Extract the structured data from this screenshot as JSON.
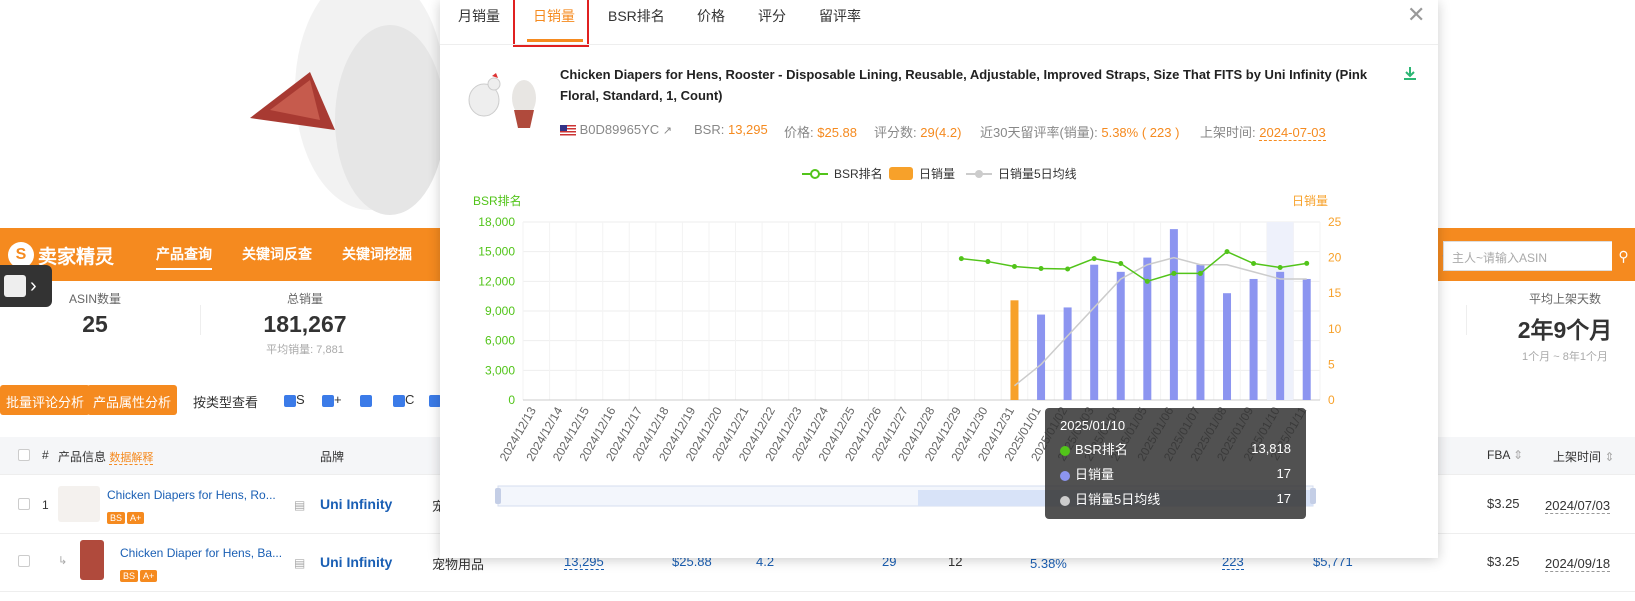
{
  "nav": {
    "logo": "卖家精灵",
    "links": [
      "产品查询",
      "关键词反查",
      "关键词挖掘"
    ],
    "search_placeholder": "主人~请输入ASIN"
  },
  "stats": [
    {
      "label": "ASIN数量",
      "value": "25",
      "sub": ""
    },
    {
      "label": "总销量",
      "value": "181,267",
      "sub": "平均销量: 7,881"
    },
    {
      "label": "平均上架天数",
      "value": "2年9个月",
      "sub": "1个月 ~ 8年1个月"
    }
  ],
  "toolbar": {
    "btn_review": "批量评论分析",
    "btn_attr": "产品属性分析",
    "by_type": "按类型查看",
    "filters": [
      "S",
      "+",
      "",
      "C",
      ""
    ]
  },
  "table": {
    "headers": {
      "num": "#",
      "info": "产品信息",
      "info_link": "数据解释",
      "brand": "品牌",
      "fba": "FBA",
      "date": "上架时间"
    },
    "rows": [
      {
        "num": "1",
        "title": "Chicken Diapers for Hens, Ro...",
        "badges": [
          "BS",
          "A+"
        ],
        "brand": "Uni Infinity",
        "cat": "宠",
        "fba": "$3.25",
        "date": "2024/07/03"
      },
      {
        "num": "",
        "title": "Chicken Diaper for Hens, Ba...",
        "badges": [
          "BS",
          "A+"
        ],
        "brand": "Uni Infinity",
        "cat": "宠物用品",
        "bsr": "13,295",
        "price": "$25.88",
        "rating": "4.2",
        "reviews": "29",
        "x12": "12",
        "rate": "5.38%",
        "n223": "223",
        "rev": "$5,771",
        "fba": "$3.25",
        "date": "2024/09/18"
      }
    ]
  },
  "modal": {
    "tabs": [
      "月销量",
      "日销量",
      "BSR排名",
      "价格",
      "评分",
      "留评率"
    ],
    "active_tab": 1,
    "product_title": "Chicken Diapers for Hens, Rooster - Disposable Lining, Reusable, Adjustable, Improved Straps, Size That FITS by Uni Infinity (Pink Floral, Standard, 1, Count)",
    "asin": "B0D89965YC",
    "bsr_label": "BSR:",
    "bsr": "13,295",
    "price_label": "价格:",
    "price": "$25.88",
    "reviews_label": "评分数:",
    "reviews": "29(4.2)",
    "rate_label": "近30天留评率(销量):",
    "rate": "5.38% ( 223 )",
    "listed_label": "上架时间:",
    "listed": "2024-07-03"
  },
  "tooltip": {
    "date": "2025/01/10",
    "rows": [
      {
        "name": "BSR排名",
        "value": "13,818",
        "color": "#52c41a"
      },
      {
        "name": "日销量",
        "value": "17",
        "color": "#8c95f0"
      },
      {
        "name": "日销量5日均线",
        "value": "17",
        "color": "#cccccc"
      }
    ]
  },
  "chart_data": {
    "type": "bar",
    "title": "",
    "ylabel_left": "BSR排名",
    "ylabel_right": "日销量",
    "ylim_left": [
      0,
      18000
    ],
    "ylim_right": [
      0,
      25
    ],
    "yticks_left": [
      "0",
      "3,000",
      "6,000",
      "9,000",
      "12,000",
      "15,000",
      "18,000"
    ],
    "yticks_right": [
      "0",
      "5",
      "10",
      "15",
      "20",
      "25"
    ],
    "legend_position": "top-center",
    "categories": [
      "2024/12/13",
      "2024/12/14",
      "2024/12/15",
      "2024/12/16",
      "2024/12/17",
      "2024/12/18",
      "2024/12/19",
      "2024/12/20",
      "2024/12/21",
      "2024/12/22",
      "2024/12/23",
      "2024/12/24",
      "2024/12/25",
      "2024/12/26",
      "2024/12/27",
      "2024/12/28",
      "2024/12/29",
      "2024/12/30",
      "2024/12/31",
      "2025/01/01",
      "2025/01/02",
      "2025/01/03",
      "2025/01/04",
      "2025/01/05",
      "2025/01/06",
      "2025/01/07",
      "2025/01/08",
      "2025/01/09",
      "2025/01/10",
      "2025/01/11"
    ],
    "series": [
      {
        "name": "BSR排名",
        "axis": "left",
        "kind": "line",
        "color": "#52c41a",
        "values": [
          null,
          null,
          null,
          null,
          null,
          null,
          null,
          null,
          null,
          null,
          null,
          null,
          null,
          null,
          null,
          null,
          14300,
          14000,
          13500,
          13300,
          13250,
          14300,
          13800,
          12000,
          12800,
          12800,
          15000,
          13800,
          13400,
          13818,
          13900
        ]
      },
      {
        "name": "日销量",
        "axis": "right",
        "kind": "bar",
        "values": [
          null,
          null,
          null,
          null,
          null,
          null,
          null,
          null,
          null,
          null,
          null,
          null,
          null,
          null,
          null,
          null,
          null,
          null,
          14,
          12,
          13,
          19,
          18,
          20,
          24,
          19,
          15,
          17,
          18,
          17,
          17
        ],
        "colors": {
          "early": "#f7a12a",
          "normal": "#8c95f0"
        }
      },
      {
        "name": "日销量5日均线",
        "axis": "right",
        "kind": "line",
        "color": "#cccccc",
        "values": [
          null,
          null,
          null,
          null,
          null,
          null,
          null,
          null,
          null,
          null,
          null,
          null,
          null,
          null,
          null,
          null,
          null,
          null,
          2,
          5,
          9,
          13,
          17,
          19,
          20,
          19,
          19,
          18,
          17,
          17,
          17
        ]
      }
    ]
  }
}
